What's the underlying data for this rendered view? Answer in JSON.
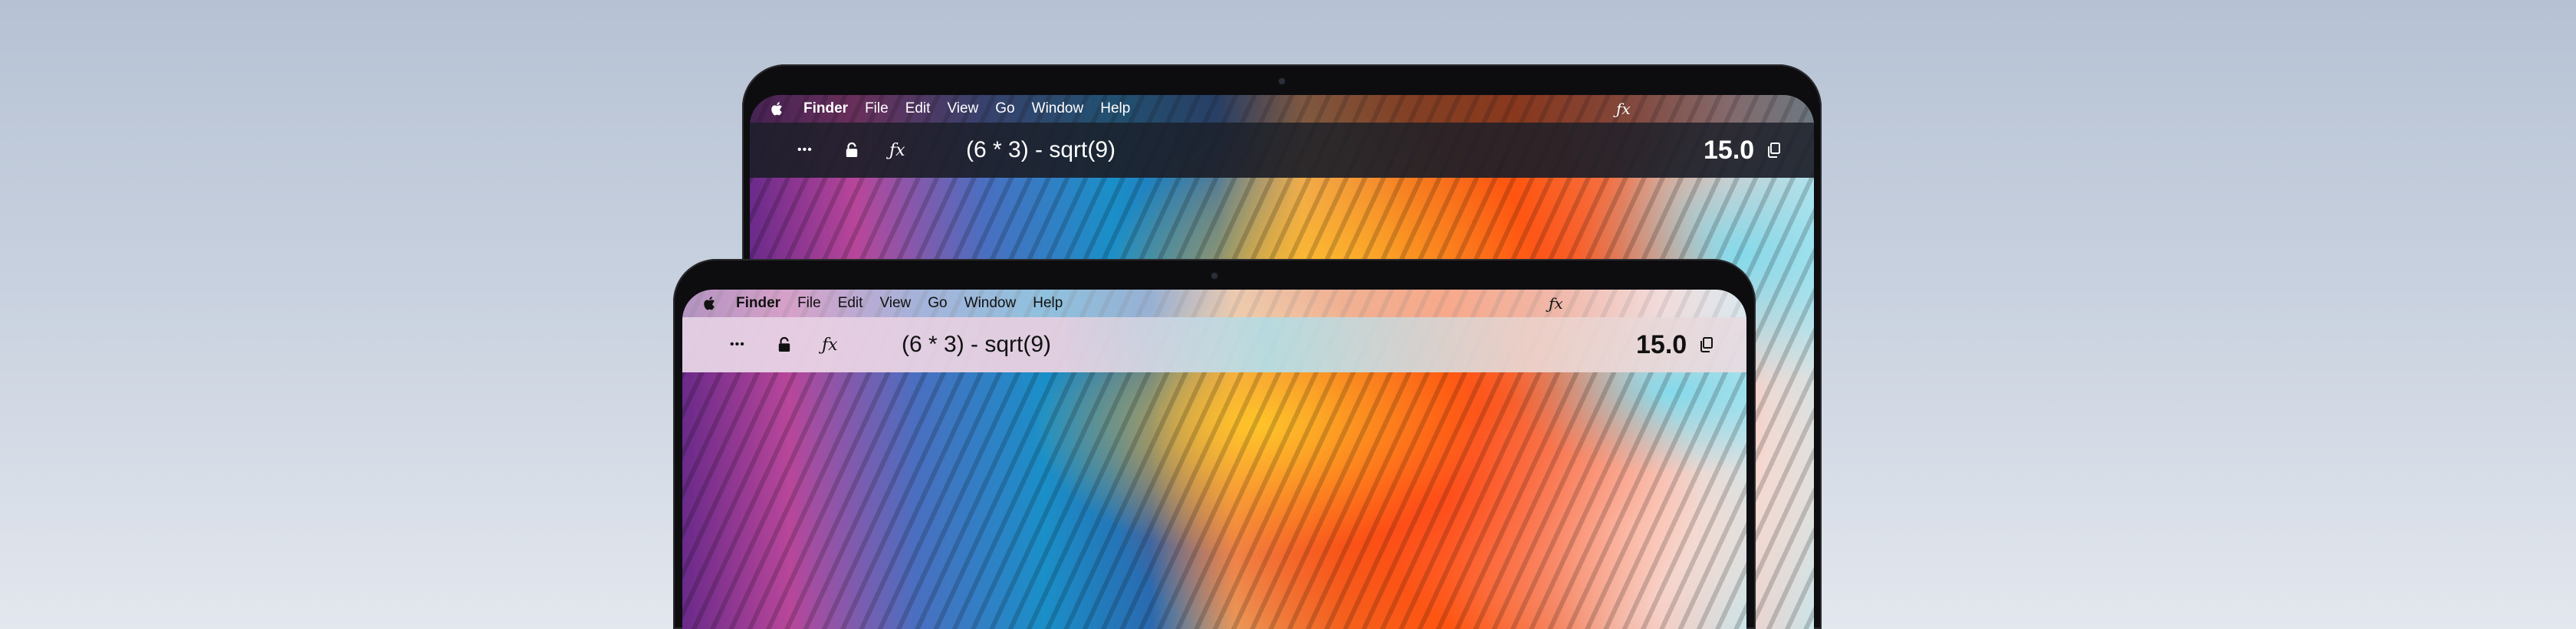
{
  "menu": {
    "app_name": "Finder",
    "items": [
      "File",
      "Edit",
      "View",
      "Go",
      "Window",
      "Help"
    ],
    "fx_glyph": "ƒx"
  },
  "calculator": {
    "more_glyph": "•••",
    "fx_glyph": "ƒx",
    "expression": "(6 * 3) - sqrt(9)",
    "result": "15.0"
  },
  "icons": {
    "apple": "apple-logo-icon",
    "more": "more-icon",
    "lock": "lock-icon",
    "function": "function-icon",
    "copy": "copy-icon"
  },
  "colors": {
    "background_top": "#b6c2d4",
    "background_bottom": "#e3e7ee",
    "dark_bar": "#1c1e28"
  }
}
